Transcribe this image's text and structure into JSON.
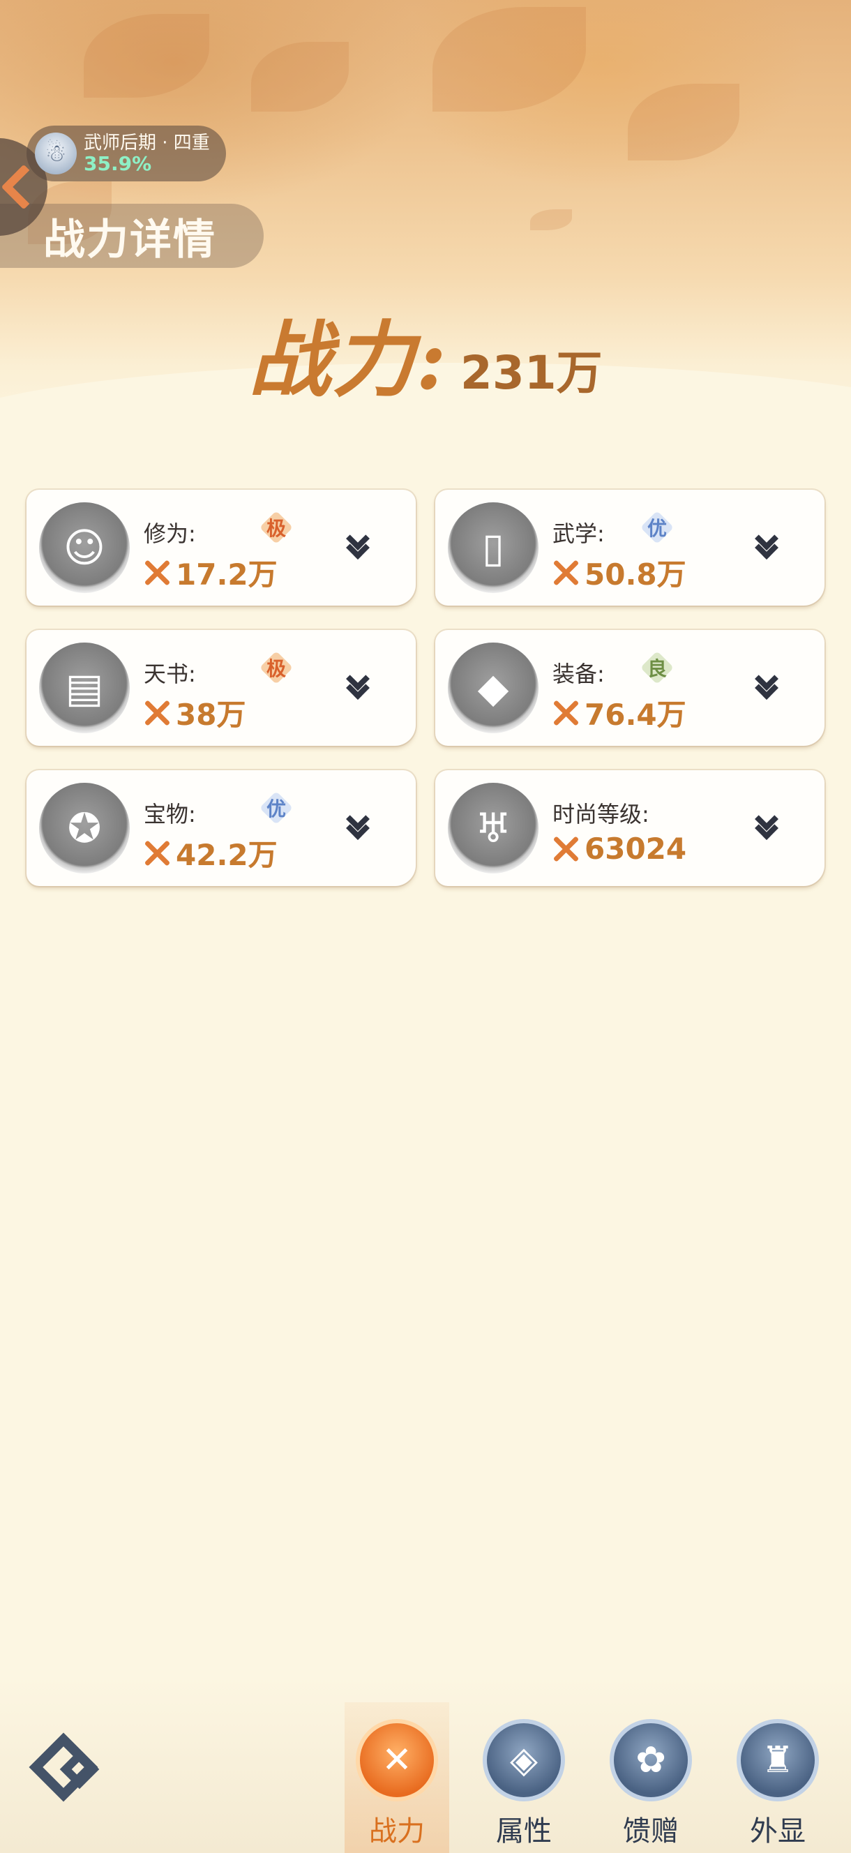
{
  "header": {
    "rank": {
      "name": "武师后期 · 四重",
      "progress": "35.9%"
    },
    "page_title": "战力详情"
  },
  "power": {
    "label": "战力:",
    "value": "231万"
  },
  "cards": [
    {
      "label": "修为:",
      "grade": "极",
      "grade_tier": "ji",
      "value": "17.2万",
      "icon": "cultivation-icon"
    },
    {
      "label": "武学:",
      "grade": "优",
      "grade_tier": "you",
      "value": "50.8万",
      "icon": "martial-book-icon"
    },
    {
      "label": "天书:",
      "grade": "极",
      "grade_tier": "ji",
      "value": "38万",
      "icon": "heavenly-book-icon"
    },
    {
      "label": "装备:",
      "grade": "良",
      "grade_tier": "liang",
      "value": "76.4万",
      "icon": "equipment-icon"
    },
    {
      "label": "宝物:",
      "grade": "优",
      "grade_tier": "you",
      "value": "42.2万",
      "icon": "treasure-icon"
    },
    {
      "label": "时尚等级:",
      "grade": "",
      "grade_tier": "",
      "value": "63024",
      "icon": "fashion-icon"
    }
  ],
  "grade_colors": {
    "ji": "#d9612c",
    "you": "#5d83c7",
    "liang": "#6e8f45"
  },
  "accent_color": "#c77a2e",
  "nav": {
    "tabs": [
      {
        "label": "战力",
        "icon": "crossed-swords-icon",
        "active": true
      },
      {
        "label": "属性",
        "icon": "shield-swirl-icon",
        "active": false
      },
      {
        "label": "馈赠",
        "icon": "gift-bag-icon",
        "active": false
      },
      {
        "label": "外显",
        "icon": "armor-icon",
        "active": false
      }
    ]
  }
}
